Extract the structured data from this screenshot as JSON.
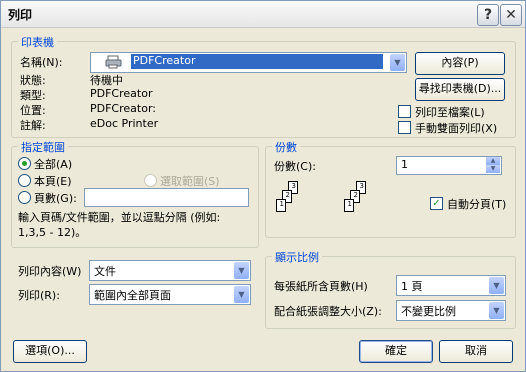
{
  "window": {
    "title": "列印",
    "help_label": "?",
    "close_label": "✕"
  },
  "printer_group": {
    "label": "印表機",
    "name_label": "名稱(N):",
    "name_value": "PDFCreator",
    "status_label": "狀態:",
    "status_value": "待機中",
    "type_label": "類型:",
    "type_value": "PDFCreator",
    "where_label": "位置:",
    "where_value": "PDFCreator:",
    "comment_label": "註解:",
    "comment_value": "eDoc Printer",
    "properties_button": "內容(P)",
    "find_button": "尋找印表機(D)...",
    "print_to_file_label": "列印至檔案(L)",
    "manual_duplex_label": "手動雙面列印(X)"
  },
  "range_group": {
    "label": "指定範圍",
    "all_label": "全部(A)",
    "current_label": "本頁(E)",
    "selection_label": "選取範圍(S)",
    "pages_label": "頁數(G):",
    "pages_value": "",
    "hint": "輸入頁碼/文件範圍，並以逗點分隔 (例如: 1,3,5 - 12)。"
  },
  "copies_group": {
    "label": "份數",
    "copies_label": "份數(C):",
    "copies_value": "1",
    "collate_label": "自動分頁(T)"
  },
  "print_what": {
    "label": "列印內容(W)",
    "value": "文件"
  },
  "print": {
    "label": "列印(R):",
    "value": "範圍內全部頁面"
  },
  "zoom_group": {
    "label": "顯示比例",
    "pages_per_sheet_label": "每張紙所含頁數(H)",
    "pages_per_sheet_value": "1 頁",
    "scale_label": "配合紙張調整大小(Z):",
    "scale_value": "不變更比例"
  },
  "buttons": {
    "options": "選項(O)...",
    "ok": "確定",
    "cancel": "取消"
  }
}
